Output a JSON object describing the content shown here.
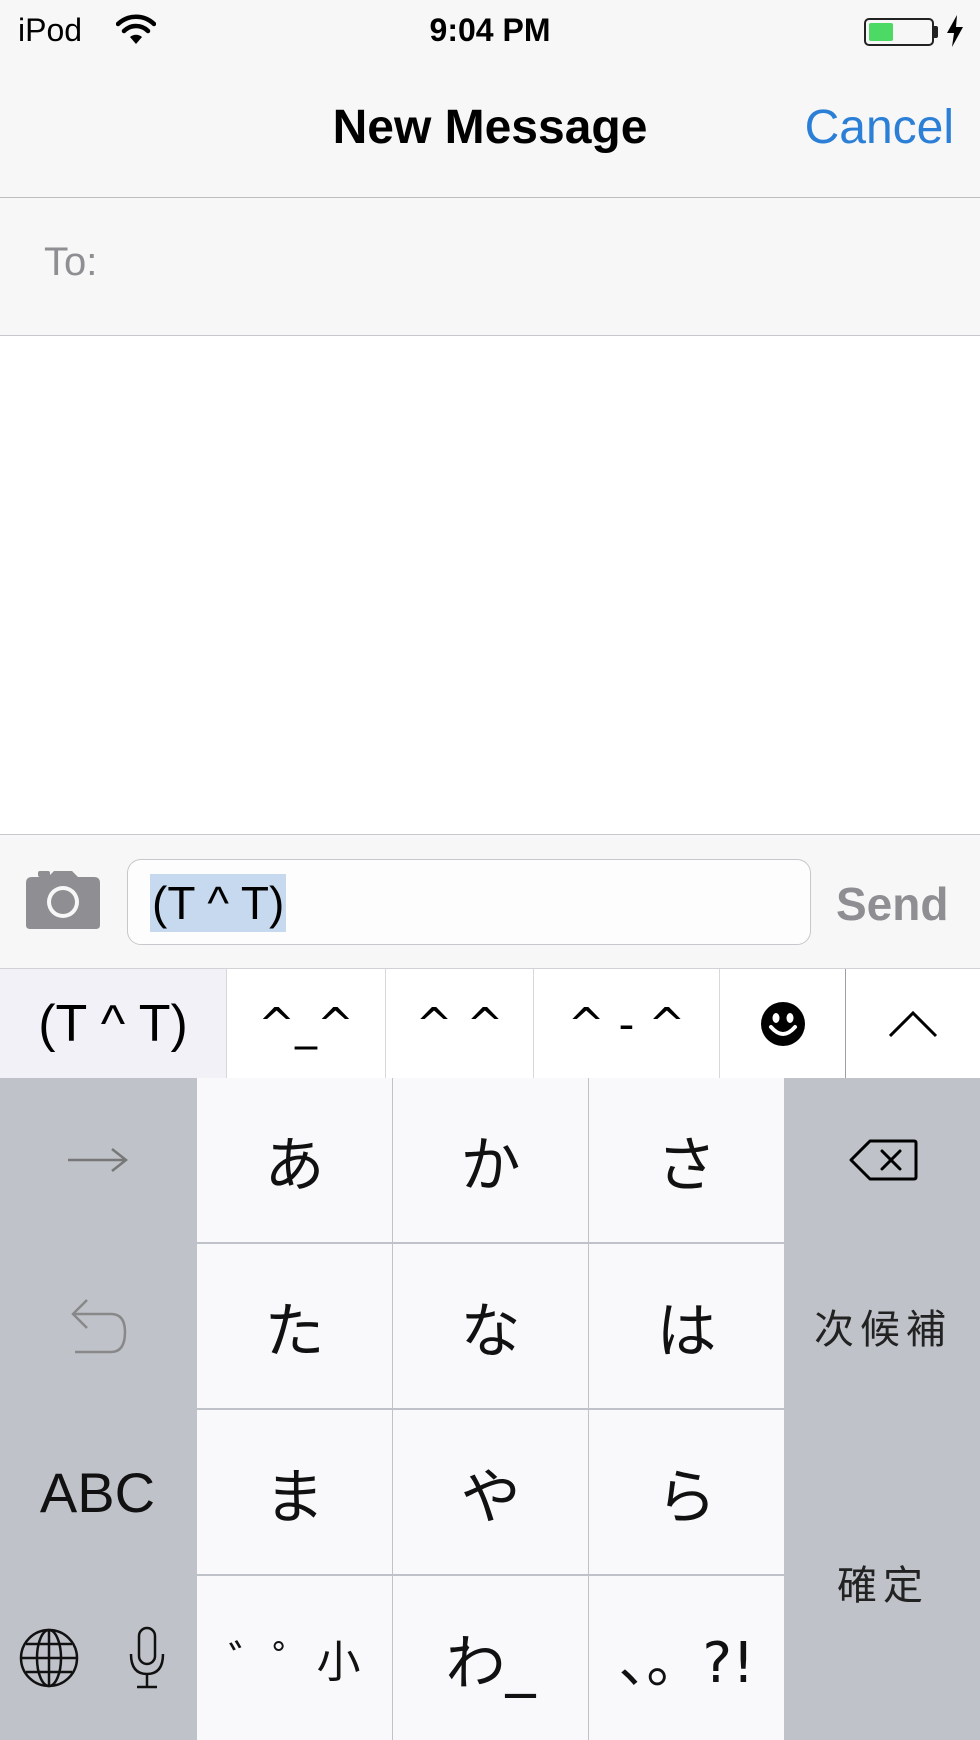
{
  "status": {
    "carrier": "iPod",
    "time": "9:04 PM",
    "battery_level": 0.4,
    "battery_color": "#4cd964"
  },
  "nav": {
    "title": "New Message",
    "cancel_label": "Cancel",
    "accent": "#2c7fd6"
  },
  "to": {
    "label": "To:",
    "value": ""
  },
  "compose": {
    "text": "(T ^ T)",
    "send_label": "Send",
    "camera_icon": "camera-icon"
  },
  "candidates": [
    "(T ^ T)",
    "^_^",
    "^ ^",
    "^ - ^"
  ],
  "candidate_icons": {
    "emoji": "smiley-face-icon",
    "expand": "chevron-up-icon"
  },
  "keyboard": {
    "row1": [
      "あ",
      "か",
      "さ"
    ],
    "row2": [
      "た",
      "な",
      "は"
    ],
    "row3": [
      "ま",
      "や",
      "ら"
    ],
    "row4": [
      "゛゜小",
      "わ_",
      "、。?!"
    ],
    "next_candidate": "次候補",
    "confirm": "確定",
    "abc": "ABC",
    "icons": {
      "arrow": "right-arrow-icon",
      "undo": "undo-icon",
      "delete": "delete-icon",
      "globe": "globe-icon",
      "mic": "microphone-icon"
    }
  }
}
